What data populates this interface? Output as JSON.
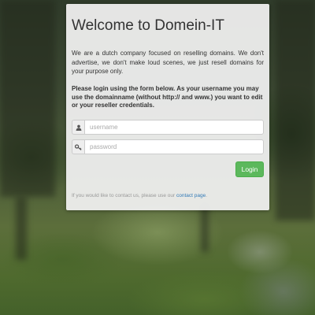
{
  "login_panel": {
    "title": "Welcome to Domein-IT",
    "intro": "We are a dutch company focused on reselling domains. We don't advertise, we don't make loud scenes, we just resell domains for your purpose only.",
    "instructions": "Please login using the form below. As your username you may use the domainname (without http:// and www.) you want to edit or your reseller credentials.",
    "username": {
      "value": "",
      "placeholder": "username",
      "icon": "user-icon"
    },
    "password": {
      "value": "",
      "placeholder": "password",
      "icon": "key-icon"
    },
    "login_label": "Login",
    "contact_prefix": "If you would like to contact us, please use our",
    "contact_link": "contact page",
    "contact_suffix": "."
  },
  "colors": {
    "button": "#5cb85c",
    "link": "#337ab7",
    "panel": "#f0f0f0"
  }
}
